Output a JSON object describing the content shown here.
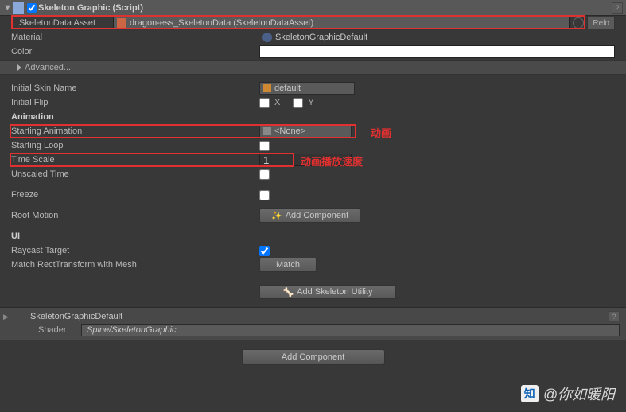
{
  "component": {
    "title": "Skeleton Graphic (Script)",
    "skeletonDataAsset": {
      "label": "SkeletonData Asset",
      "value": "dragon-ess_SkeletonData (SkeletonDataAsset)",
      "reload": "Relo"
    },
    "material": {
      "label": "Material",
      "value": "SkeletonGraphicDefault"
    },
    "color": {
      "label": "Color"
    },
    "advanced": "Advanced...",
    "initialSkinName": {
      "label": "Initial Skin Name",
      "value": "default"
    },
    "initialFlip": {
      "label": "Initial Flip",
      "x": "X",
      "y": "Y"
    },
    "animationSection": "Animation",
    "startingAnimation": {
      "label": "Starting Animation",
      "value": "<None>"
    },
    "startingLoop": {
      "label": "Starting Loop"
    },
    "timeScale": {
      "label": "Time Scale",
      "value": "1"
    },
    "unscaledTime": {
      "label": "Unscaled Time"
    },
    "freeze": {
      "label": "Freeze"
    },
    "rootMotion": {
      "label": "Root Motion",
      "button": "Add Component"
    },
    "uiSection": "UI",
    "raycastTarget": {
      "label": "Raycast Target"
    },
    "matchRect": {
      "label": "Match RectTransform with Mesh",
      "button": "Match"
    },
    "addSkeletonUtility": "Add Skeleton Utility"
  },
  "material": {
    "name": "SkeletonGraphicDefault",
    "shaderLabel": "Shader",
    "shader": "Spine/SkeletonGraphic"
  },
  "addComponent": "Add Component",
  "annotations": {
    "anim": "动画",
    "speed": "动画播放速度"
  },
  "watermark": {
    "logo": "知",
    "text": "@你如暖阳"
  }
}
